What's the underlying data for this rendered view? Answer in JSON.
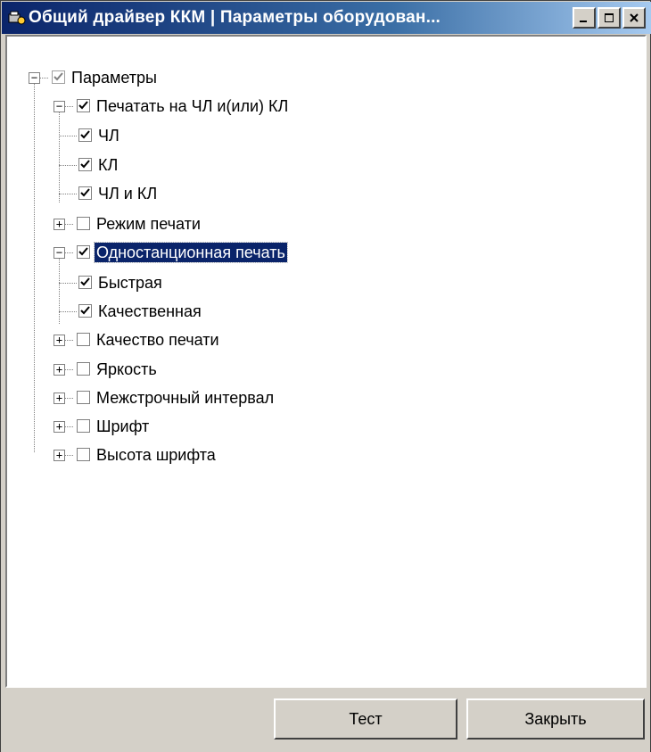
{
  "window": {
    "title": "Общий драйвер ККМ | Параметры оборудован...",
    "icon": "driver-app-icon"
  },
  "tree": {
    "root": {
      "label": "Параметры",
      "checked": true,
      "expanded": true
    },
    "nodes": [
      {
        "label": "Печатать на ЧЛ и(или) КЛ",
        "checked": true,
        "expanded": true,
        "children": [
          {
            "label": "ЧЛ",
            "checked": true
          },
          {
            "label": "КЛ",
            "checked": true
          },
          {
            "label": "ЧЛ и КЛ",
            "checked": true
          }
        ]
      },
      {
        "label": "Режим печати",
        "checked": false,
        "expanded": false
      },
      {
        "label": "Одностанционная печать",
        "checked": true,
        "expanded": true,
        "selected": true,
        "children": [
          {
            "label": "Быстрая",
            "checked": true
          },
          {
            "label": "Качественная",
            "checked": true
          }
        ]
      },
      {
        "label": "Качество печати",
        "checked": false,
        "expanded": false
      },
      {
        "label": "Яркость",
        "checked": false,
        "expanded": false
      },
      {
        "label": "Межстрочный интервал",
        "checked": false,
        "expanded": false
      },
      {
        "label": "Шрифт",
        "checked": false,
        "expanded": false
      },
      {
        "label": "Высота шрифта",
        "checked": false,
        "expanded": false
      }
    ]
  },
  "buttons": {
    "test_label": "Тест",
    "close_label": "Закрыть"
  }
}
